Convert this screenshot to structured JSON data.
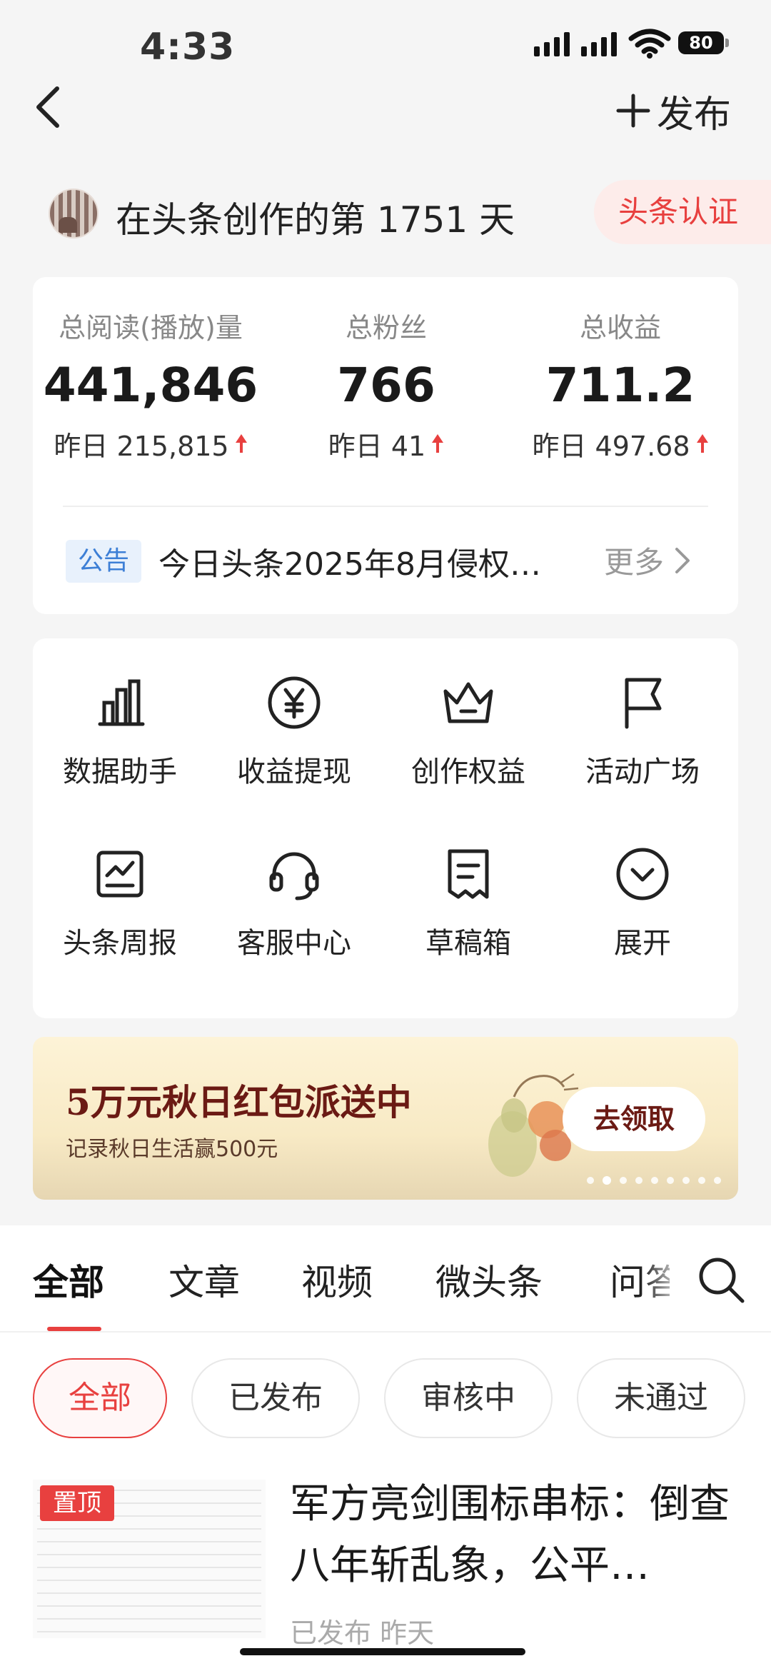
{
  "status_bar": {
    "time": "4:33",
    "battery": "80"
  },
  "header": {
    "publish_label": "发布"
  },
  "creator": {
    "days_text": "在头条创作的第 1751 天",
    "certification": "头条认证"
  },
  "stats": [
    {
      "label": "总阅读(播放)量",
      "value": "441,846",
      "delta": "昨日 215,815"
    },
    {
      "label": "总粉丝",
      "value": "766",
      "delta": "昨日 41"
    },
    {
      "label": "总收益",
      "value": "711.2",
      "delta": "昨日 497.68"
    }
  ],
  "notice": {
    "tag": "公告",
    "text": "今日头条2025年8月侵权…",
    "more": "更多"
  },
  "tools": [
    {
      "label": "数据助手",
      "icon": "bar-chart-icon"
    },
    {
      "label": "收益提现",
      "icon": "yuan-coin-icon"
    },
    {
      "label": "创作权益",
      "icon": "crown-icon"
    },
    {
      "label": "活动广场",
      "icon": "flag-icon"
    },
    {
      "label": "头条周报",
      "icon": "report-chart-icon"
    },
    {
      "label": "客服中心",
      "icon": "headset-icon"
    },
    {
      "label": "草稿箱",
      "icon": "draft-icon"
    },
    {
      "label": "展开",
      "icon": "expand-icon"
    }
  ],
  "banner": {
    "title": "5万元秋日红包派送中",
    "subtitle": "记录秋日生活赢500元",
    "button": "去领取",
    "slide_count": 9,
    "active_slide": 2
  },
  "content_tabs": [
    "全部",
    "文章",
    "视频",
    "微头条",
    "问答"
  ],
  "filters": [
    "全部",
    "已发布",
    "审核中",
    "未通过"
  ],
  "post": {
    "pin": "置顶",
    "title": "军方亮剑围标串标：倒查八年斩乱象，公平…",
    "meta": "已发布 昨天"
  },
  "colors": {
    "accent": "#e8403f",
    "notice_blue": "#3d7fd6",
    "banner_text": "#6b1a14"
  }
}
